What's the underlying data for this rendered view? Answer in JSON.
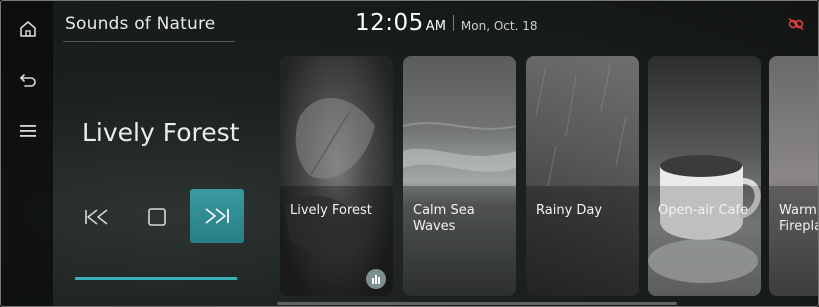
{
  "header": {
    "app_title": "Sounds of Nature",
    "time": "12:05",
    "ampm": "AM",
    "date": "Mon, Oct. 18"
  },
  "icons": {
    "home": "home-icon",
    "back": "back-arrow-icon",
    "menu": "menu-icon",
    "status": "link-off-icon",
    "prev": "skip-previous-icon",
    "stop": "stop-icon",
    "next": "skip-next-icon",
    "playing": "equalizer-icon"
  },
  "player": {
    "now_playing": "Lively Forest",
    "progress_fraction": 0.99
  },
  "cards": [
    {
      "label": "Lively Forest",
      "playing": true
    },
    {
      "label": "Calm Sea\nWaves",
      "playing": false
    },
    {
      "label": "Rainy Day",
      "playing": false
    },
    {
      "label": "Open-air Cafe",
      "playing": false
    },
    {
      "label": "Warm\nFirepla",
      "playing": false
    }
  ],
  "colors": {
    "accent": "#2f8c93",
    "status_icon": "#e0403a"
  }
}
